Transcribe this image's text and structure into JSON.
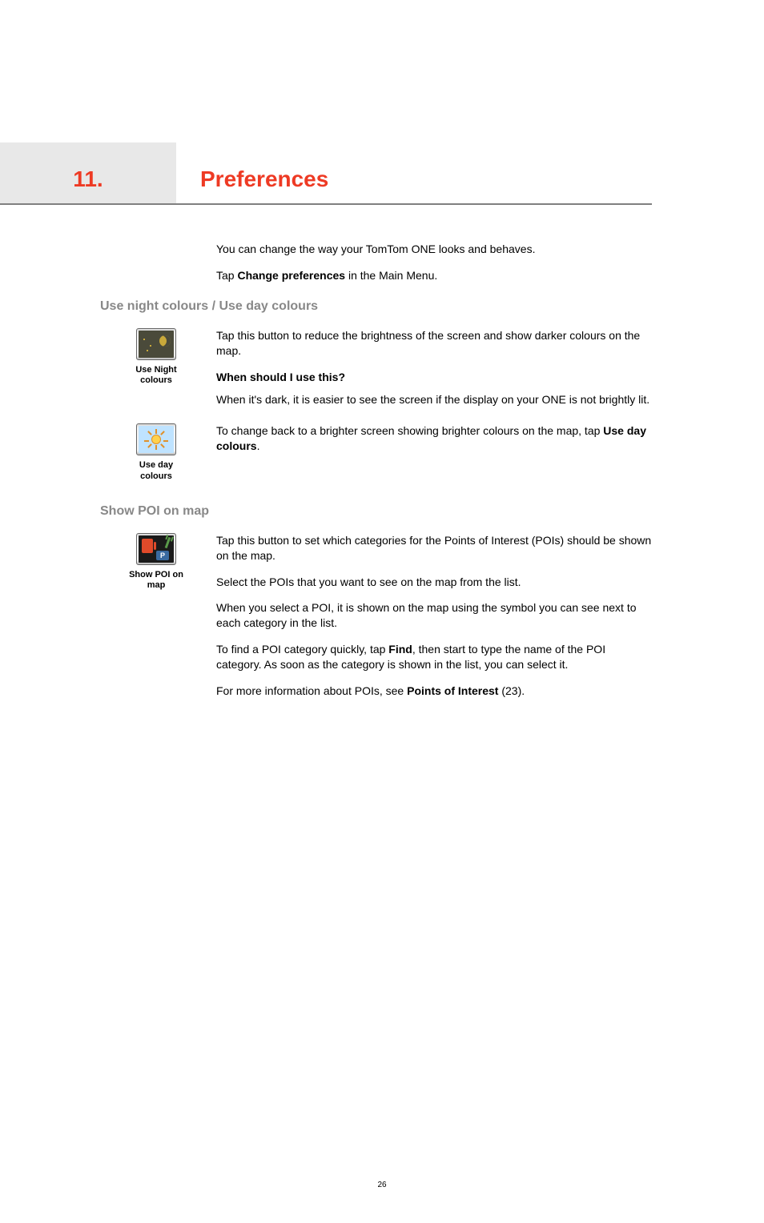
{
  "chapter": {
    "number": "11.",
    "title": "Preferences"
  },
  "intro": {
    "p1_prefix": "You can change the way your TomTom ONE looks and behaves.",
    "p2_prefix": "Tap ",
    "p2_bold": "Change preferences",
    "p2_suffix": " in the Main Menu."
  },
  "section1": {
    "title": "Use night colours / Use day colours",
    "night": {
      "caption_l1": "Use Night",
      "caption_l2": "colours",
      "p1": "Tap this button to reduce the brightness of the screen and show darker colours on the map.",
      "sub": "When should I use this?",
      "p2": "When it's dark, it is easier to see the screen if the display on your ONE is not brightly lit."
    },
    "day": {
      "caption_l1": "Use day",
      "caption_l2": "colours",
      "p1_prefix": "To change back to a brighter screen showing brighter colours on the map, tap ",
      "p1_bold": "Use day colours",
      "p1_suffix": "."
    }
  },
  "section2": {
    "title": "Show POI on map",
    "caption_l1": "Show POI on",
    "caption_l2": "map",
    "poi_park_label": "P",
    "p1": "Tap this button to set which categories for the Points of Interest (POIs) should be shown on the map.",
    "p2": "Select the POIs that you want to see on the map from the list.",
    "p3": "When you select a POI, it is shown on the map using the symbol you can see next to each category in the list.",
    "p4_prefix": "To find a POI category quickly, tap ",
    "p4_bold": "Find",
    "p4_suffix": ", then start to type the name of the POI category. As soon as the category is shown in the list, you can select it.",
    "p5_prefix": "For more information about POIs, see ",
    "p5_bold": "Points of Interest",
    "p5_suffix": " (23)."
  },
  "page_number": "26"
}
